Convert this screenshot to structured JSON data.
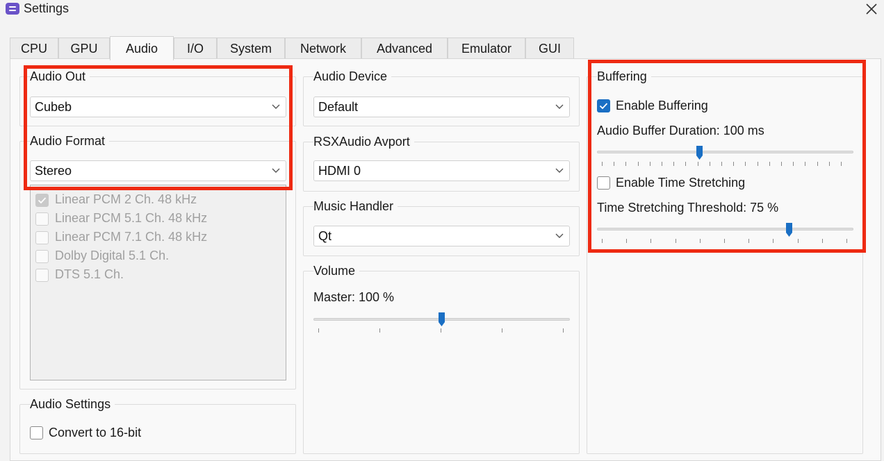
{
  "window": {
    "title": "Settings"
  },
  "tabs": [
    {
      "label": "CPU"
    },
    {
      "label": "GPU"
    },
    {
      "label": "Audio"
    },
    {
      "label": "I/O"
    },
    {
      "label": "System"
    },
    {
      "label": "Network"
    },
    {
      "label": "Advanced"
    },
    {
      "label": "Emulator"
    },
    {
      "label": "GUI"
    }
  ],
  "active_tab": "Audio",
  "audio_out": {
    "title": "Audio Out",
    "value": "Cubeb"
  },
  "audio_format": {
    "title": "Audio Format",
    "value": "Stereo",
    "options": [
      {
        "label": "Linear PCM 2 Ch. 48 kHz",
        "checked": true
      },
      {
        "label": "Linear PCM 5.1 Ch. 48 kHz",
        "checked": false
      },
      {
        "label": "Linear PCM 7.1 Ch. 48 kHz",
        "checked": false
      },
      {
        "label": "Dolby Digital 5.1 Ch.",
        "checked": false
      },
      {
        "label": "DTS 5.1 Ch.",
        "checked": false
      }
    ]
  },
  "audio_settings": {
    "title": "Audio Settings",
    "convert_16bit": {
      "label": "Convert to 16-bit",
      "checked": false
    }
  },
  "audio_device": {
    "title": "Audio Device",
    "value": "Default"
  },
  "rsx_avport": {
    "title": "RSXAudio Avport",
    "value": "HDMI 0"
  },
  "music_handler": {
    "title": "Music Handler",
    "value": "Qt"
  },
  "volume": {
    "title": "Volume",
    "master_label": "Master: 100 %",
    "level": 0.5
  },
  "buffering": {
    "title": "Buffering",
    "enable_buffering": {
      "label": "Enable Buffering",
      "checked": true
    },
    "duration_label": "Audio Buffer Duration: 100 ms",
    "duration_level": 0.4,
    "enable_time_stretching": {
      "label": "Enable Time Stretching",
      "checked": false
    },
    "threshold_label": "Time Stretching Threshold: 75 %",
    "threshold_level": 0.75
  },
  "colors": {
    "accent": "#1a6fc4",
    "highlight": "#ee2a12"
  }
}
